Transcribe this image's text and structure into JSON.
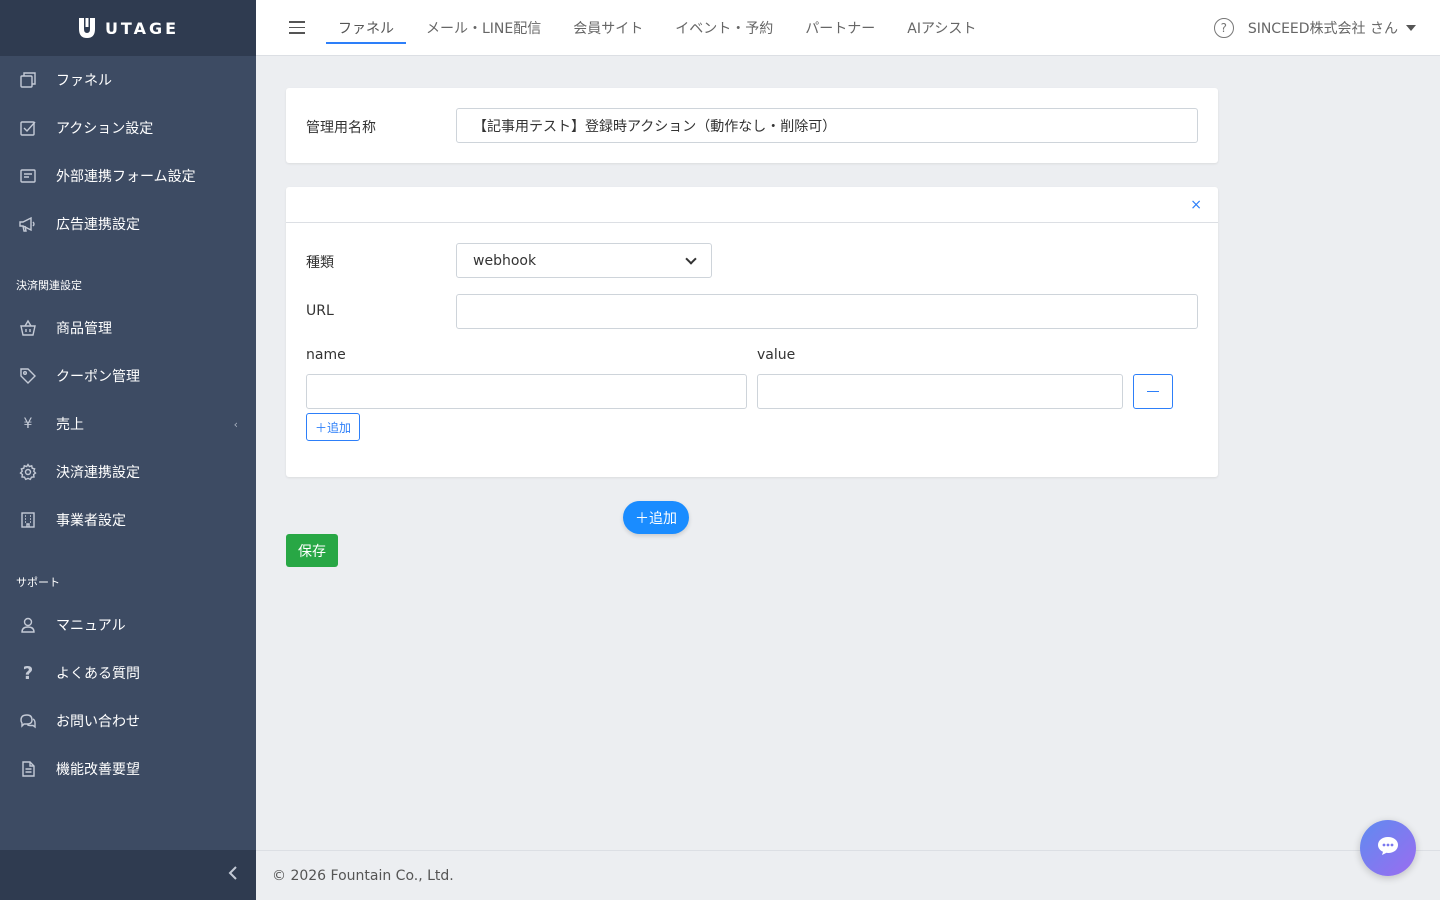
{
  "brand": {
    "name": "UTAGE"
  },
  "sidebar": {
    "items": [
      {
        "label": "ファネル",
        "icon": "copy-icon"
      },
      {
        "label": "アクション設定",
        "icon": "check-square-icon"
      },
      {
        "label": "外部連携フォーム設定",
        "icon": "form-icon"
      },
      {
        "label": "広告連携設定",
        "icon": "megaphone-icon"
      },
      {
        "label": "商品管理",
        "icon": "basket-icon"
      },
      {
        "label": "クーポン管理",
        "icon": "tag-icon"
      },
      {
        "label": "売上",
        "icon": "yen-icon"
      },
      {
        "label": "決済連携設定",
        "icon": "gear-icon"
      },
      {
        "label": "事業者設定",
        "icon": "building-icon"
      },
      {
        "label": "マニュアル",
        "icon": "person-icon"
      },
      {
        "label": "よくある質問",
        "icon": "question-icon"
      },
      {
        "label": "お問い合わせ",
        "icon": "chat-icon"
      },
      {
        "label": "機能改善要望",
        "icon": "document-icon"
      }
    ],
    "sections": {
      "payment": "決済関連設定",
      "support": "サポート"
    }
  },
  "header": {
    "tabs": [
      "ファネル",
      "メール・LINE配信",
      "会員サイト",
      "イベント・予約",
      "パートナー",
      "AIアシスト"
    ],
    "active_tab": "ファネル",
    "user": "SINCEED株式会社 さん"
  },
  "form": {
    "name_label": "管理用名称",
    "name_value": "【記事用テスト】登録時アクション（動作なし・削除可）",
    "action": {
      "close_label": "×",
      "type_label": "種類",
      "type_value": "webhook",
      "url_label": "URL",
      "url_value": "",
      "param_name_label": "name",
      "param_value_label": "value",
      "param_name_value": "",
      "param_value_value": "",
      "add_param_label": "＋追加"
    },
    "add_action_label": "＋追加",
    "save_label": "保存"
  },
  "footer": {
    "copyright": "© 2026 Fountain Co., Ltd."
  }
}
